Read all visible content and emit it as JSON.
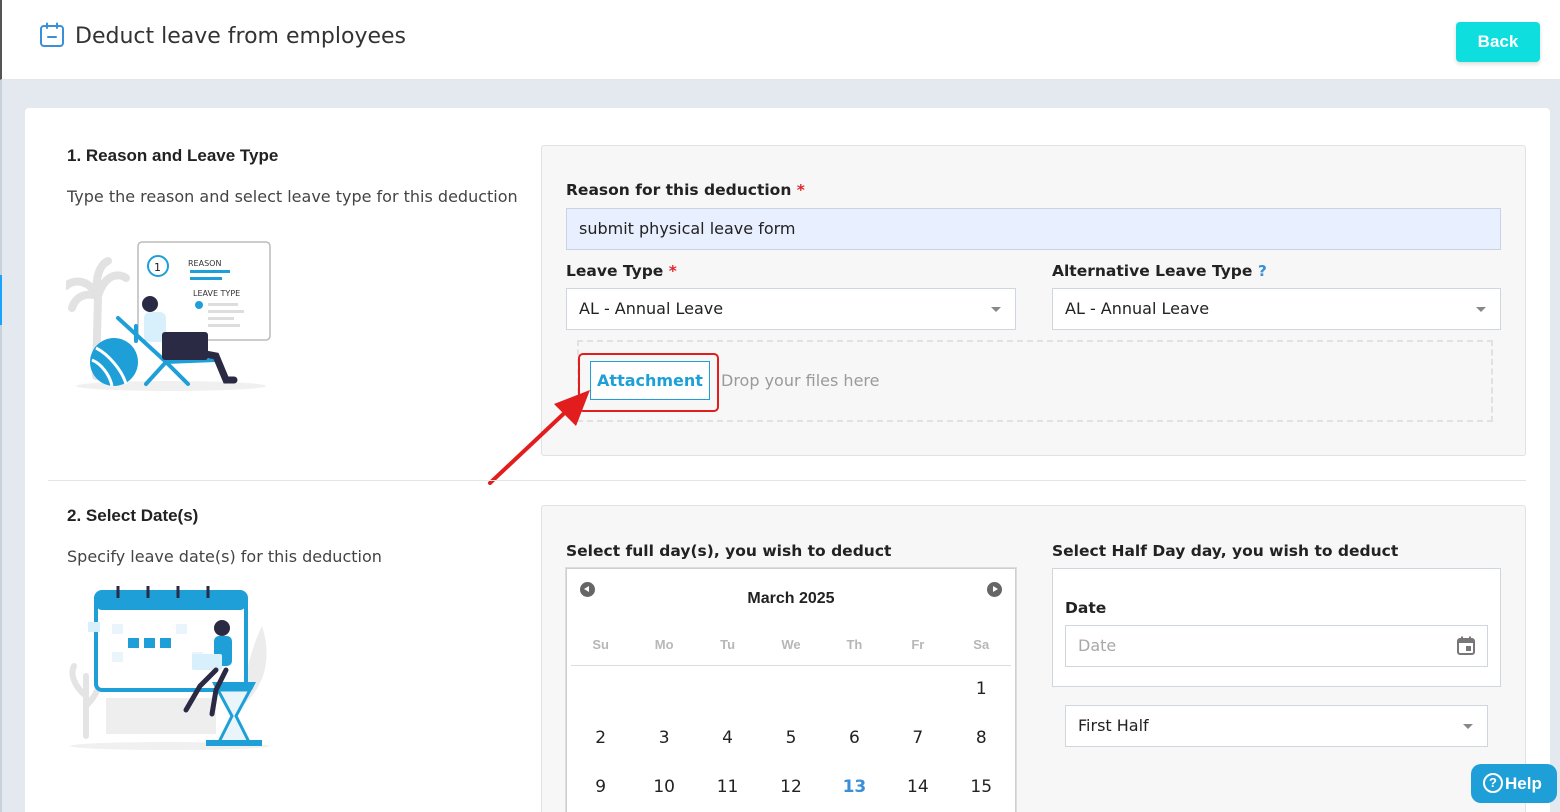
{
  "header": {
    "title": "Deduct leave from employees",
    "title_icon": "calendar-minus-icon",
    "back_label": "Back"
  },
  "section1": {
    "title": "1. Reason and Leave Type",
    "description": "Type the reason and select leave type for this deduction",
    "illustration_text": {
      "step": "1",
      "line1": "REASON",
      "line2": "LEAVE TYPE"
    },
    "reason_label": "Reason for this deduction",
    "required_mark": "*",
    "reason_value": "submit physical leave form",
    "leave_type_label": "Leave Type",
    "leave_type_value": "AL - Annual Leave",
    "alt_leave_type_label": "Alternative Leave Type",
    "alt_leave_help": "?",
    "alt_leave_type_value": "AL - Annual Leave",
    "attachment_label": "Attachment",
    "drop_text": "Drop your files here"
  },
  "section2": {
    "title": "2. Select Date(s)",
    "description": "Specify leave date(s) for this deduction",
    "full_day_label": "Select full day(s), you wish to deduct",
    "half_day_label": "Select Half Day day, you wish to deduct",
    "date_label": "Date",
    "date_placeholder": "Date",
    "half_select_value": "First Half",
    "calendar": {
      "month": "March 2025",
      "weekdays": [
        "Su",
        "Mo",
        "Tu",
        "We",
        "Th",
        "Fr",
        "Sa"
      ],
      "weeks": [
        [
          "",
          "",
          "",
          "",
          "",
          "",
          "1"
        ],
        [
          "2",
          "3",
          "4",
          "5",
          "6",
          "7",
          "8"
        ],
        [
          "9",
          "10",
          "11",
          "12",
          "13",
          "14",
          "15"
        ]
      ],
      "today": "13"
    }
  },
  "help_label": "Help",
  "colors": {
    "back_button": "#0fdede",
    "accent_blue": "#1e9fd8",
    "highlight_red": "#e11d1d",
    "required_red": "#e0262b"
  }
}
